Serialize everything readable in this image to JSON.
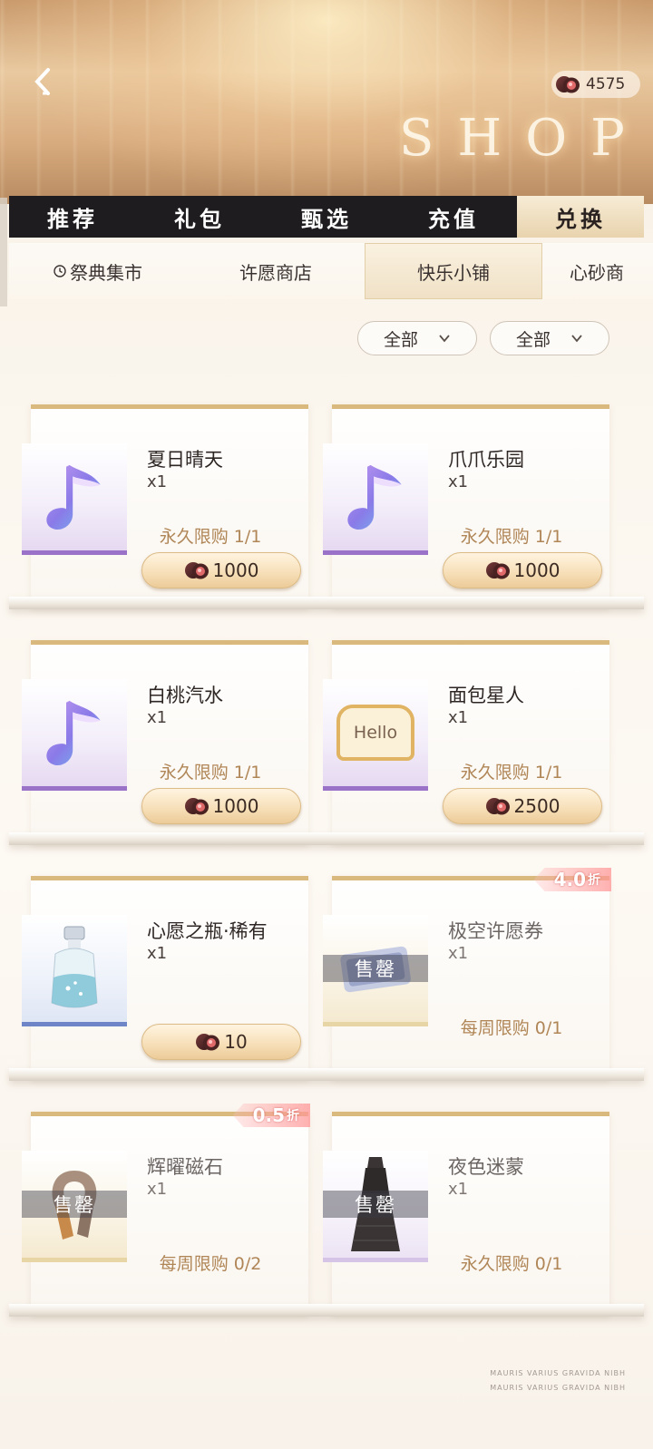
{
  "header": {
    "title": "SHOP",
    "currency_amount": "4575",
    "back_icon": "chevron-left-icon"
  },
  "main_tabs": [
    {
      "label": "推荐"
    },
    {
      "label": "礼包"
    },
    {
      "label": "甄选"
    },
    {
      "label": "充值"
    },
    {
      "label": "兑换",
      "active": true
    }
  ],
  "sub_tabs": [
    {
      "label": "祭典集市",
      "icon": "clock-icon"
    },
    {
      "label": "许愿商店"
    },
    {
      "label": "快乐小铺",
      "active": true
    },
    {
      "label": "心砂商"
    }
  ],
  "filters": [
    {
      "label": "全部"
    },
    {
      "label": "全部"
    }
  ],
  "items": [
    {
      "name": "夏日晴天",
      "qty": "x1",
      "limit": "永久限购 1/1",
      "price": "1000",
      "icon": "music-note-icon"
    },
    {
      "name": "爪爪乐园",
      "qty": "x1",
      "limit": "永久限购 1/1",
      "price": "1000",
      "icon": "music-note-icon"
    },
    {
      "name": "白桃汽水",
      "qty": "x1",
      "limit": "永久限购 1/1",
      "price": "1000",
      "icon": "music-note-icon"
    },
    {
      "name": "面包星人",
      "qty": "x1",
      "limit": "永久限购 1/1",
      "price": "2500",
      "icon": "bread-icon",
      "icon_text": "Hello"
    },
    {
      "name": "心愿之瓶·稀有",
      "qty": "x1",
      "limit": "",
      "price": "10",
      "icon": "bottle-icon"
    },
    {
      "name": "极空许愿券",
      "qty": "x1",
      "limit": "每周限购 0/1",
      "sold_out": "售罄",
      "discount": "4.0",
      "discount_unit": "折",
      "icon": "ticket-icon"
    },
    {
      "name": "辉曜磁石",
      "qty": "x1",
      "limit": "每周限购 0/2",
      "sold_out": "售罄",
      "discount": "0.5",
      "discount_unit": "折",
      "icon": "magnet-icon"
    },
    {
      "name": "夜色迷蒙",
      "qty": "x1",
      "limit": "永久限购 0/1",
      "sold_out": "售罄",
      "icon": "dress-icon"
    }
  ],
  "footer": {
    "line1": "MAURIS VARIUS GRAVIDA NIBH",
    "line2": "MAURIS VARIUS GRAVIDA NIBH"
  },
  "colors": {
    "tab_bar": "#1f1c1f",
    "tab_active": "#f7ecd6",
    "limit_text": "#b08657",
    "card_top_border": "#d9b97e"
  }
}
